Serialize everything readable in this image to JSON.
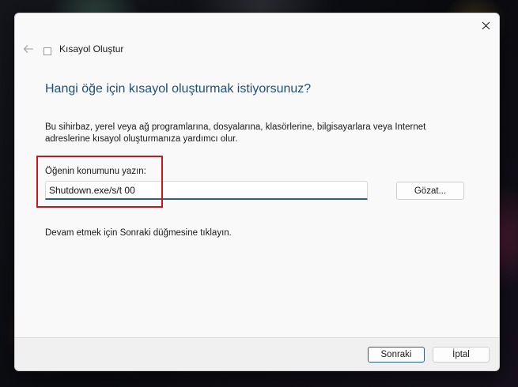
{
  "window": {
    "title": "Kısayol Oluştur",
    "close_icon": "close-icon",
    "back_icon": "arrow-left-icon",
    "title_icon": "shortcut-icon"
  },
  "wizard": {
    "heading": "Hangi öğe için kısayol oluşturmak istiyorsunuz?",
    "description": "Bu sihirbaz, yerel veya ağ programlarına, dosyalarına, klasörlerine, bilgisayarlara veya Internet adreslerine kısayol oluşturmanıza yardımcı olur.",
    "location_label": "Öğenin konumunu yazın:",
    "location_value": "Shutdown.exe/s/t 00",
    "browse_label": "Gözat...",
    "hint": "Devam etmek için Sonraki düğmesine tıklayın."
  },
  "footer": {
    "next_label": "Sonraki",
    "cancel_label": "İptal"
  },
  "colors": {
    "heading": "#1f4e79",
    "input_underline": "#2a5e8c",
    "highlight_box": "#c8161d"
  }
}
